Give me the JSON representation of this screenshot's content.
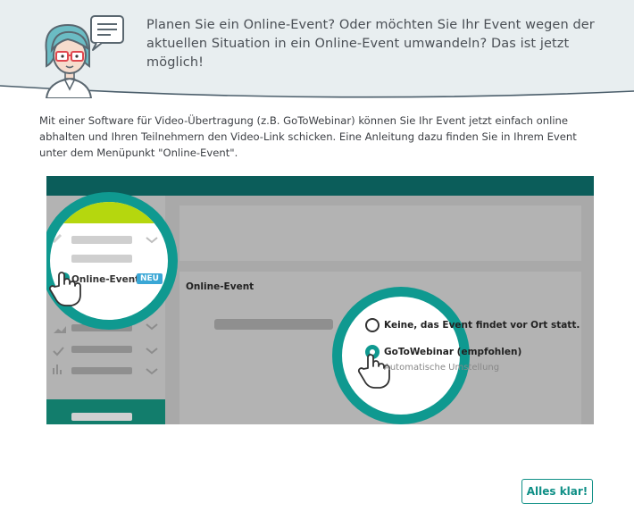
{
  "header": {
    "text": "Planen Sie ein Online-Event? Oder möchten Sie Ihr Event wegen der aktuellen Situation in ein Online-Event umwandeln? Das ist jetzt möglich!"
  },
  "intro": {
    "text": "Mit einer Software für Video-Übertragung (z.B. GoToWebinar) können Sie Ihr Event jetzt einfach online abhalten und Ihren Teilnehmern den Video-Link schicken. Eine Anleitung dazu finden Sie in Ihrem Event unter dem Menüpunkt \"Online-Event\"."
  },
  "illustration": {
    "menu_item_label": "Online-Event",
    "menu_item_badge": "NEU",
    "panel_title": "Online-Event",
    "option_1": "Keine, das Event findet vor Ort statt.",
    "option_2": "GoToWebinar (empfohlen)",
    "option_2_sub": "Automatische Umstellung"
  },
  "footer": {
    "confirm_label": "Alles klar!"
  },
  "colors": {
    "teal": "#0f9990",
    "teal_dark": "#0a5a57",
    "lime": "#b5d70e",
    "header_bg": "#e7edee"
  }
}
